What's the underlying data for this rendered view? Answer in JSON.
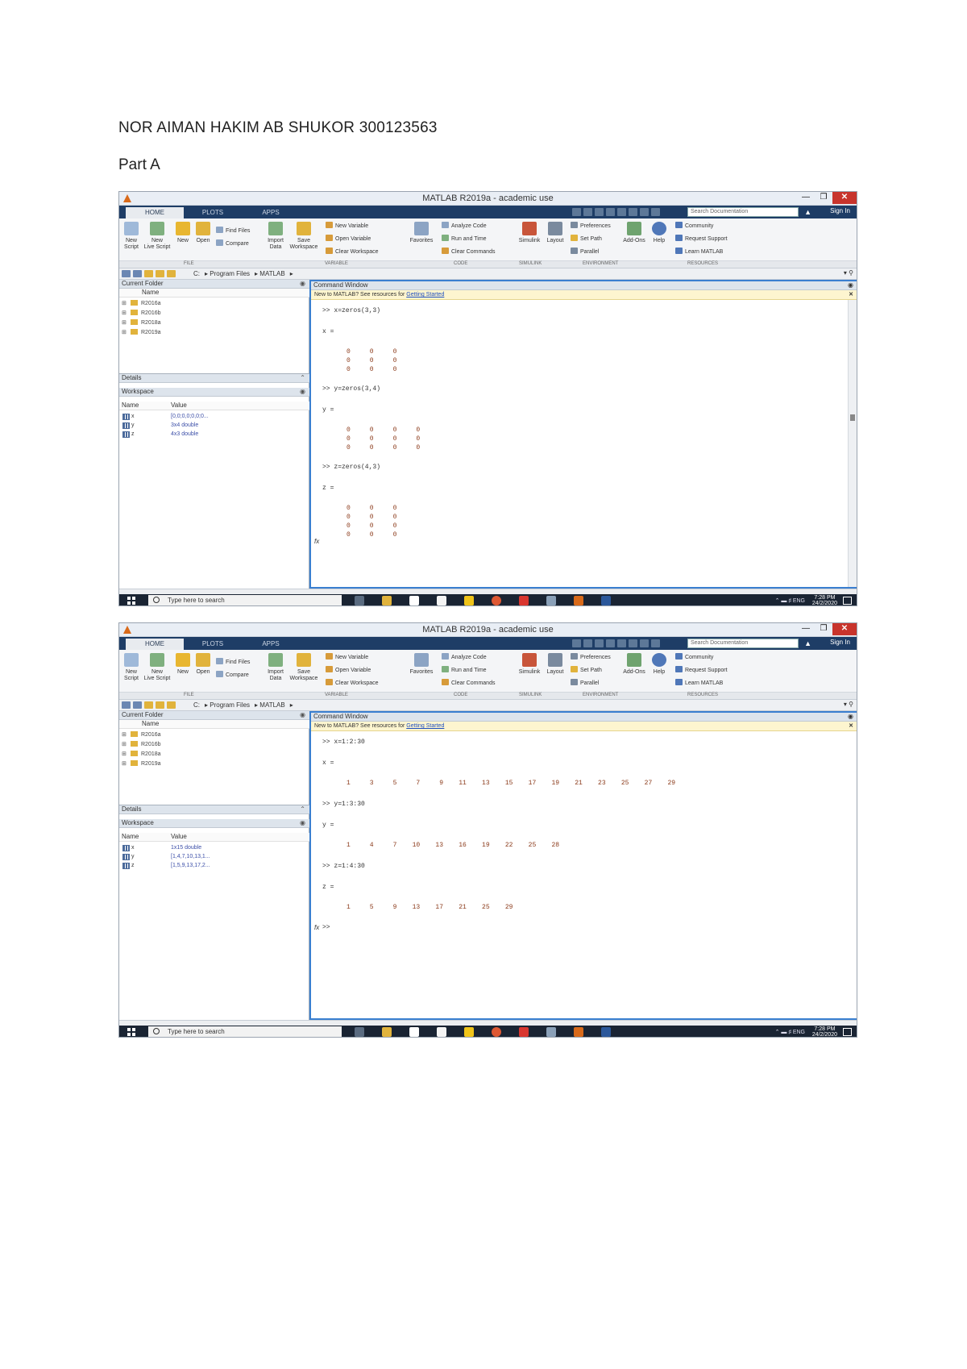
{
  "heading": "NOR AIMAN HAKIM AB SHUKOR 300123563",
  "subheading": "Part A",
  "common": {
    "window_title": "MATLAB R2019a - academic use",
    "tabs": [
      "HOME",
      "PLOTS",
      "APPS"
    ],
    "search_placeholder": "Search Documentation",
    "sign_in": "Sign In",
    "ribbon": {
      "new_script": "New\nScript",
      "new_live_script": "New\nLive Script",
      "new": "New",
      "open": "Open",
      "find_files": "Find Files",
      "compare": "Compare",
      "import_data": "Import\nData",
      "save_workspace": "Save\nWorkspace",
      "new_variable": "New Variable",
      "open_variable": "Open Variable",
      "clear_workspace": "Clear Workspace",
      "favorites": "Favorites",
      "analyze_code": "Analyze Code",
      "run_and_time": "Run and Time",
      "clear_commands": "Clear Commands",
      "simulink": "Simulink",
      "layout": "Layout",
      "preferences": "Preferences",
      "set_path": "Set Path",
      "parallel": "Parallel",
      "add_ons": "Add-Ons",
      "help": "Help",
      "community": "Community",
      "request_support": "Request Support",
      "learn_matlab": "Learn MATLAB",
      "sections": [
        "FILE",
        "VARIABLE",
        "CODE",
        "SIMULINK",
        "ENVIRONMENT",
        "RESOURCES"
      ]
    },
    "panes": {
      "current_folder": "Current Folder",
      "name_col": "Name",
      "details": "Details",
      "workspace": "Workspace",
      "value_col": "Value",
      "command_window": "Command Window"
    },
    "infobar_text": "New to MATLAB? See resources for ",
    "infobar_link": "Getting Started",
    "taskbar_search": "Type here to search",
    "clock_time": "7:28 PM",
    "clock_date": "24/2/2020",
    "fx": "fx"
  },
  "shot1": {
    "path": [
      "C:",
      "Program Files",
      "MATLAB"
    ],
    "folders": [
      "R2016a",
      "R2016b",
      "R2018a",
      "R2019a"
    ],
    "workspace_vars": [
      {
        "name": "x",
        "value": "[0,0;0,0;0,0;0..."
      },
      {
        "name": "y",
        "value": "3x4 double"
      },
      {
        "name": "z",
        "value": "4x3 double"
      }
    ],
    "lines": {
      "c1": ">> x=zeros(3,3)",
      "o1": "x =",
      "m1": [
        "0     0     0",
        "0     0     0",
        "0     0     0"
      ],
      "c2": ">> y=zeros(3,4)",
      "o2": "y =",
      "m2": [
        "0     0     0     0",
        "0     0     0     0",
        "0     0     0     0"
      ],
      "c3": ">> z=zeros(4,3)",
      "o3": "z =",
      "m3": [
        "0     0     0",
        "0     0     0",
        "0     0     0",
        "0     0     0"
      ]
    }
  },
  "shot2": {
    "path": [
      "C:",
      "Program Files",
      "MATLAB"
    ],
    "folders": [
      "R2016a",
      "R2016b",
      "R2018a",
      "R2019a"
    ],
    "workspace_vars": [
      {
        "name": "x",
        "value": "1x15 double"
      },
      {
        "name": "y",
        "value": "[1,4,7,10,13,1..."
      },
      {
        "name": "z",
        "value": "[1,5,9,13,17,2..."
      }
    ],
    "lines": {
      "c1": ">> x=1:2:30",
      "o1": "x =",
      "r1": "1     3     5     7     9    11    13    15    17    19    21    23    25    27    29",
      "c2": ">> y=1:3:30",
      "o2": "y =",
      "r2": "1     4     7    10    13    16    19    22    25    28",
      "c3": ">> z=1:4:30",
      "o3": "z =",
      "r3": "1     5     9    13    17    21    25    29",
      "prompt": ">>"
    }
  }
}
